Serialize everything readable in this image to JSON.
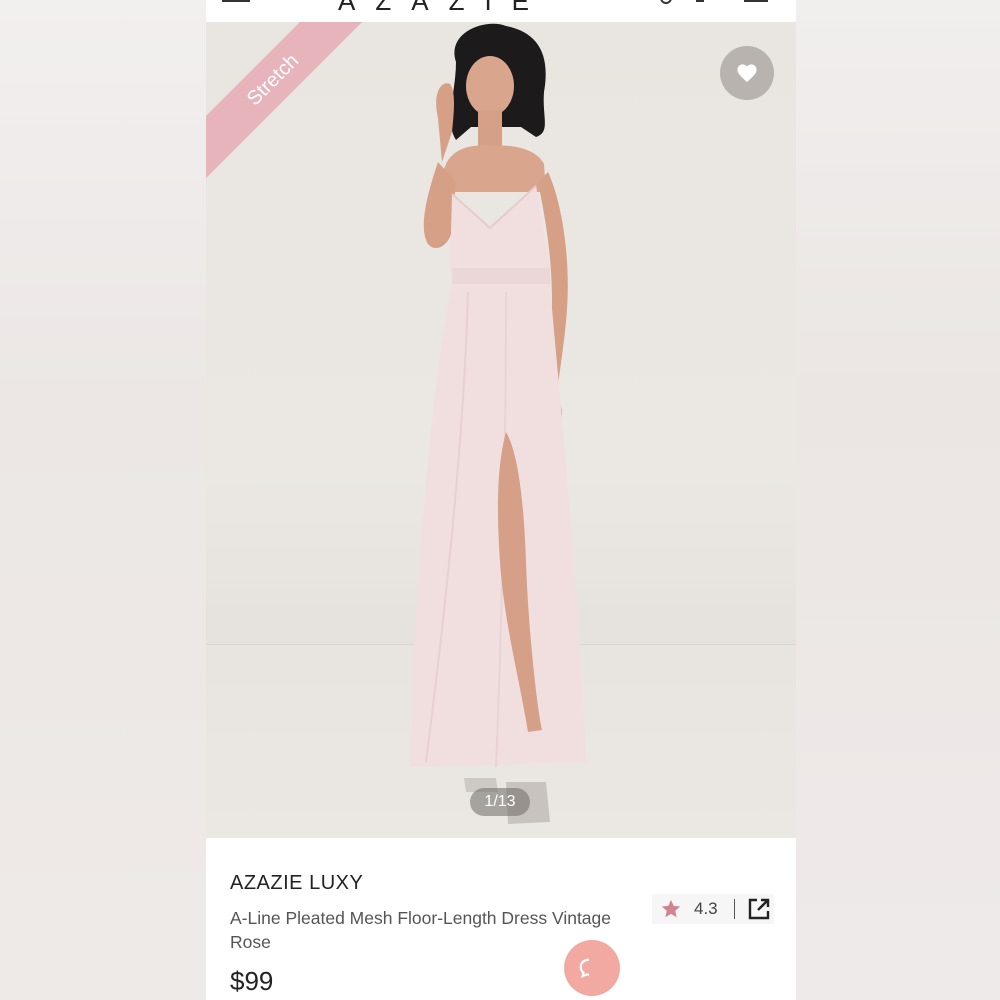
{
  "header": {
    "logo": "AZAZIE"
  },
  "hero": {
    "badge": "Stretch",
    "image_counter": "1/13",
    "dress_color": "#f1dfe0",
    "skin_color": "#d9a58c",
    "hair_color": "#1c1a1a"
  },
  "product": {
    "brand": "AZAZIE LUXY",
    "name": "A-Line Pleated Mesh Floor-Length Dress Vintage Rose",
    "price": "$99",
    "rating": "4.3"
  },
  "colors": {
    "badge": "#e8b4bc",
    "star": "#d2848e",
    "chat": "#f2a9a2"
  },
  "icons": {
    "favorite": "heart-icon",
    "share": "external-link-icon",
    "rating": "star-icon",
    "chat": "chat-icon"
  }
}
